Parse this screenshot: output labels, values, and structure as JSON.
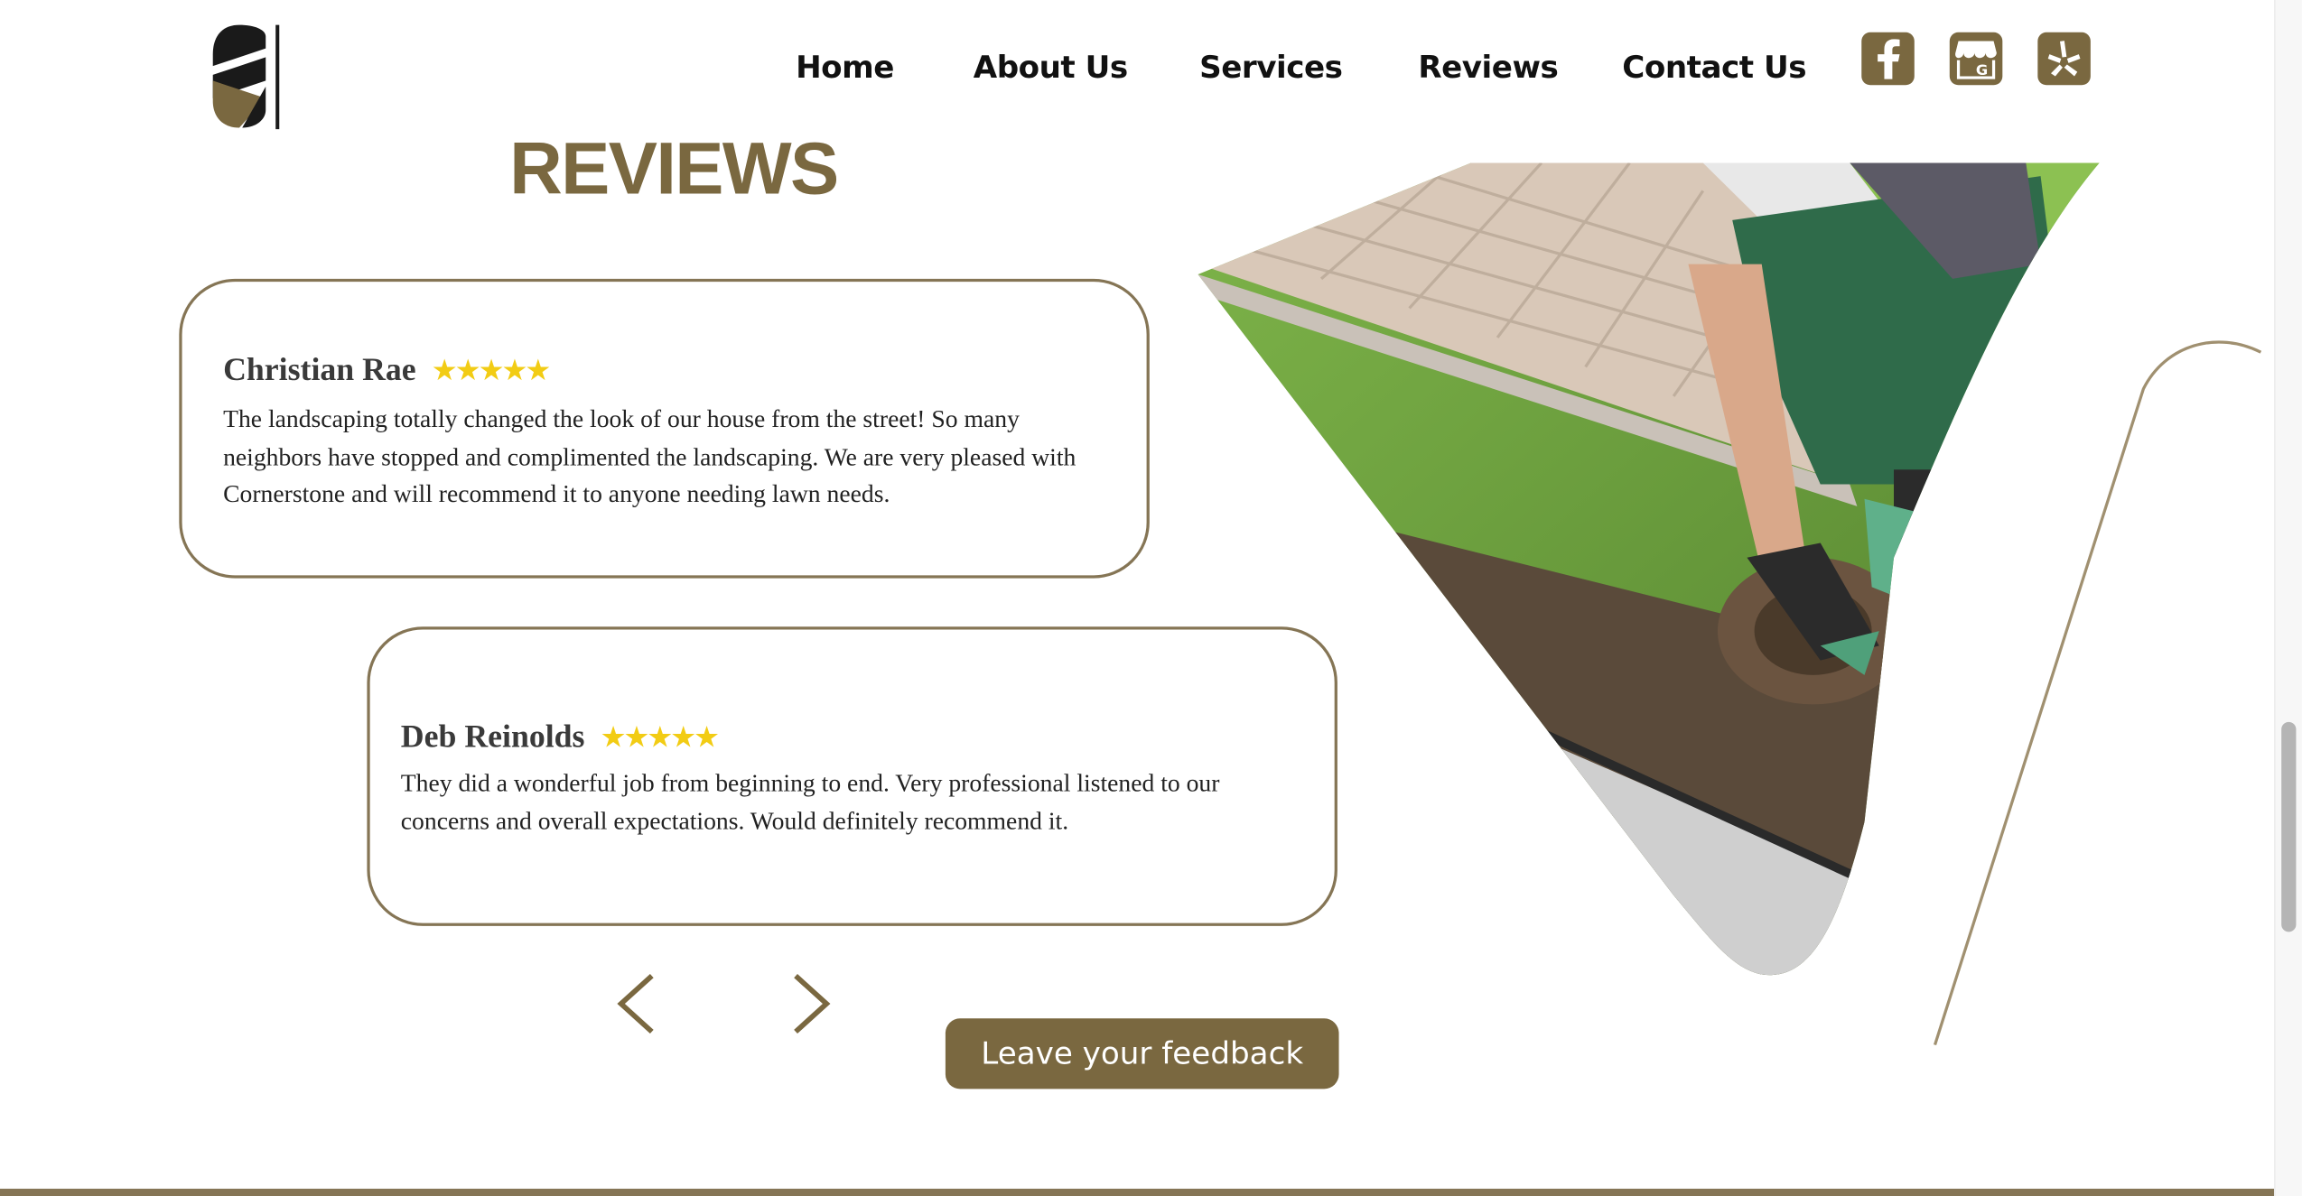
{
  "nav": {
    "items": [
      {
        "label": "Home"
      },
      {
        "label": "About Us"
      },
      {
        "label": "Services"
      },
      {
        "label": "Reviews"
      },
      {
        "label": "Contact Us"
      }
    ],
    "social": [
      {
        "icon": "facebook-icon"
      },
      {
        "icon": "google-business-icon"
      },
      {
        "icon": "yelp-icon"
      }
    ]
  },
  "section": {
    "title": "REVIEWS"
  },
  "reviews": [
    {
      "name": "Christian Rae",
      "stars": "★★★★★",
      "rating": 5,
      "text": "The landscaping totally changed the look of our house from the street! So many neighbors have stopped and complimented the landscaping. We are very pleased with Cornerstone and will recommend it to anyone needing lawn needs."
    },
    {
      "name": "Deb Reinolds",
      "stars": "★★★★★",
      "rating": 5,
      "text": "They did a wonderful job from beginning to end. Very professional listened to our concerns and overall expectations. Would definitely recommend it."
    }
  ],
  "controls": {
    "feedback_label": "Leave your feedback"
  },
  "colors": {
    "brand": "#7a6840",
    "border": "#857555",
    "star": "#f2cc14"
  }
}
